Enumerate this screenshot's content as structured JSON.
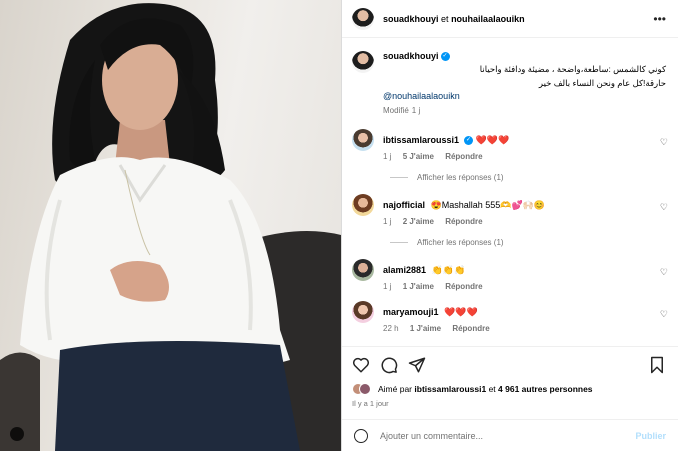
{
  "header": {
    "user1": "souadkhouyi",
    "conj": "et",
    "user2": "nouhailaalaouikn"
  },
  "caption": {
    "username": "souadkhouyi",
    "line1": "كوني كالشمس :ساطعة،واضحة ، مضيئة ودافئة واحيانا",
    "line2": "حارقة!كل عام ونحن النساء بالف خير",
    "mention": "@nouhailaalaouikn",
    "edited": "Modifié",
    "time": "1 j"
  },
  "comments": [
    {
      "username": "ibtissamlaroussi1",
      "verified": true,
      "text": "❤️❤️❤️",
      "time": "1 j",
      "likes": "5 J'aime",
      "reply": "Répondre",
      "replies": "Afficher les réponses (1)"
    },
    {
      "username": "najofficial",
      "verified": false,
      "text": "😍Mashallah 555🫶💕🙌🏻😊",
      "time": "1 j",
      "likes": "2 J'aime",
      "reply": "Répondre",
      "replies": "Afficher les réponses (1)"
    },
    {
      "username": "alami2881",
      "verified": false,
      "text": "👏👏👏",
      "time": "1 j",
      "likes": "1 J'aime",
      "reply": "Répondre"
    },
    {
      "username": "maryamouji1",
      "verified": false,
      "text": "❤️❤️❤️",
      "time": "22 h",
      "likes": "1 J'aime",
      "reply": "Répondre"
    }
  ],
  "likes": {
    "prefix": "Aimé par",
    "user": "ibtissamlaroussi1",
    "conj": "et",
    "others": "4 961 autres personnes"
  },
  "posted": "Il y a 1 jour",
  "composer": {
    "placeholder": "Ajouter un commentaire...",
    "post_label": "Publier"
  },
  "colors": {
    "link": "#00376b",
    "muted": "#737373",
    "verified": "#0095f6",
    "post_disabled": "#b2dffc"
  },
  "icons": [
    "more-icon",
    "heart-icon",
    "comment-icon",
    "share-icon",
    "bookmark-icon",
    "emoji-icon",
    "tag-icon"
  ]
}
